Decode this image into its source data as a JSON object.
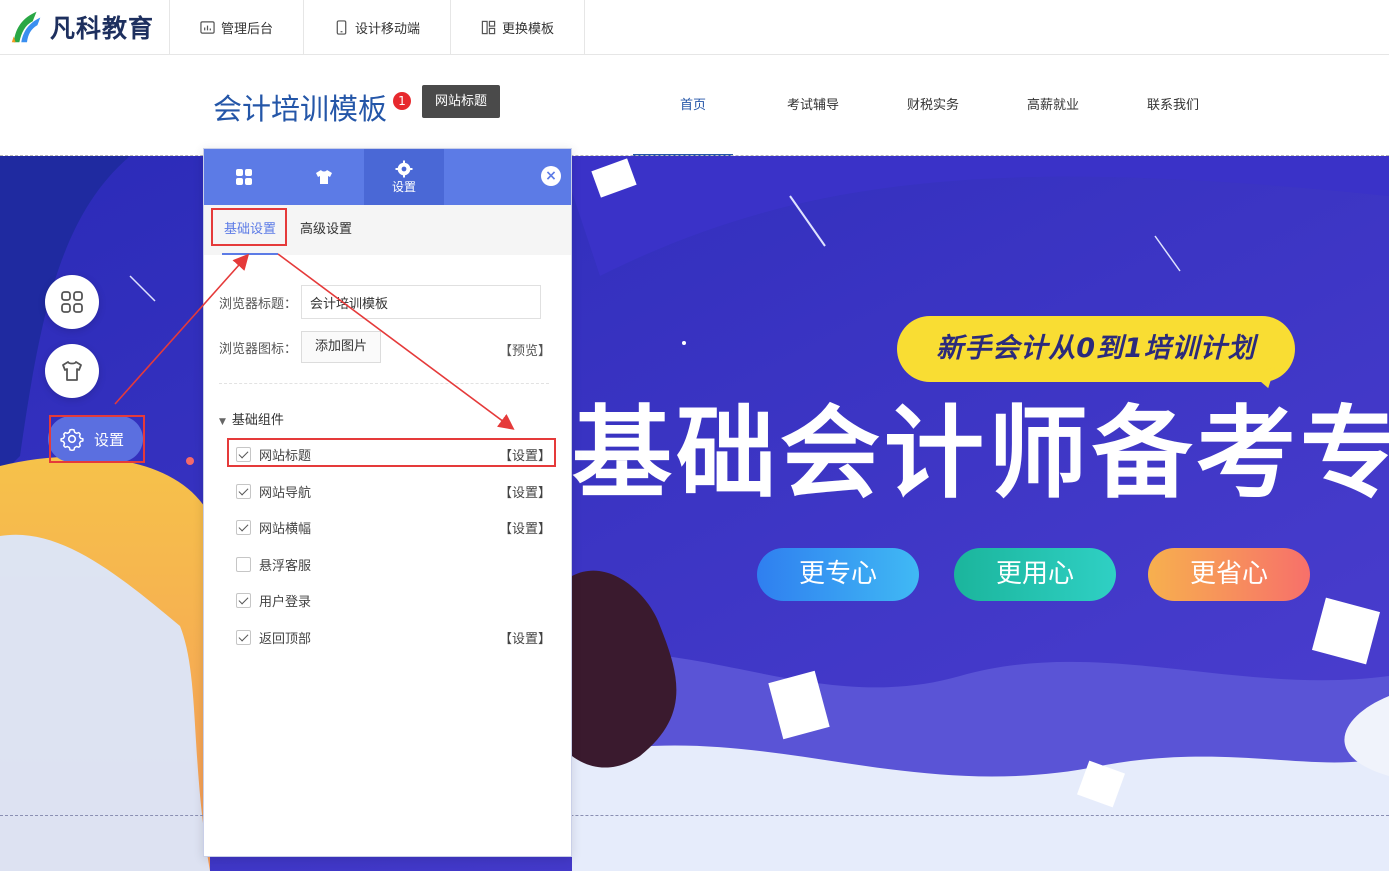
{
  "logo": {
    "text": "凡科教育"
  },
  "toolbar": {
    "items": [
      {
        "label": "管理后台",
        "icon": "chart-bar-icon"
      },
      {
        "label": "设计移动端",
        "icon": "mobile-icon"
      },
      {
        "label": "更换模板",
        "icon": "template-icon"
      }
    ]
  },
  "site": {
    "title": "会计培训模板",
    "badge": "1",
    "tooltip": "网站标题",
    "nav": [
      "首页",
      "考试辅导",
      "财税实务",
      "高薪就业",
      "联系我们"
    ],
    "nav_active_index": 0
  },
  "banner": {
    "slogan": "新手会计从0到1培训计划",
    "headline": "基础会计师备考专",
    "buttons": [
      "更专心",
      "更用心",
      "更省心"
    ]
  },
  "float_buttons": {
    "settings_label": "设置"
  },
  "panel": {
    "tabs": [
      {
        "label": "",
        "icon": "grid-icon"
      },
      {
        "label": "",
        "icon": "shirt-icon"
      },
      {
        "label": "设置",
        "icon": "gear-icon"
      }
    ],
    "active_tab": 2,
    "close_glyph": "×",
    "subtabs": [
      "基础设置",
      "高级设置"
    ],
    "browser_title_label": "浏览器标题：",
    "browser_title_value": "会计培训模板",
    "browser_icon_label": "浏览器图标：",
    "add_image_label": "添加图片",
    "preview_label": "【预览】",
    "group_label": "基础组件",
    "components": [
      {
        "label": "网站标题",
        "checked": true,
        "action": "【设置】"
      },
      {
        "label": "网站导航",
        "checked": true,
        "action": "【设置】"
      },
      {
        "label": "网站横幅",
        "checked": true,
        "action": "【设置】"
      },
      {
        "label": "悬浮客服",
        "checked": false,
        "action": ""
      },
      {
        "label": "用户登录",
        "checked": true,
        "action": ""
      },
      {
        "label": "返回顶部",
        "checked": true,
        "action": "【设置】"
      }
    ]
  },
  "colors": {
    "accent": "#5c7be6",
    "brand_blue": "#2456a8",
    "highlight_red": "#e53a3a",
    "banner_bg": "#3b2fc4"
  }
}
